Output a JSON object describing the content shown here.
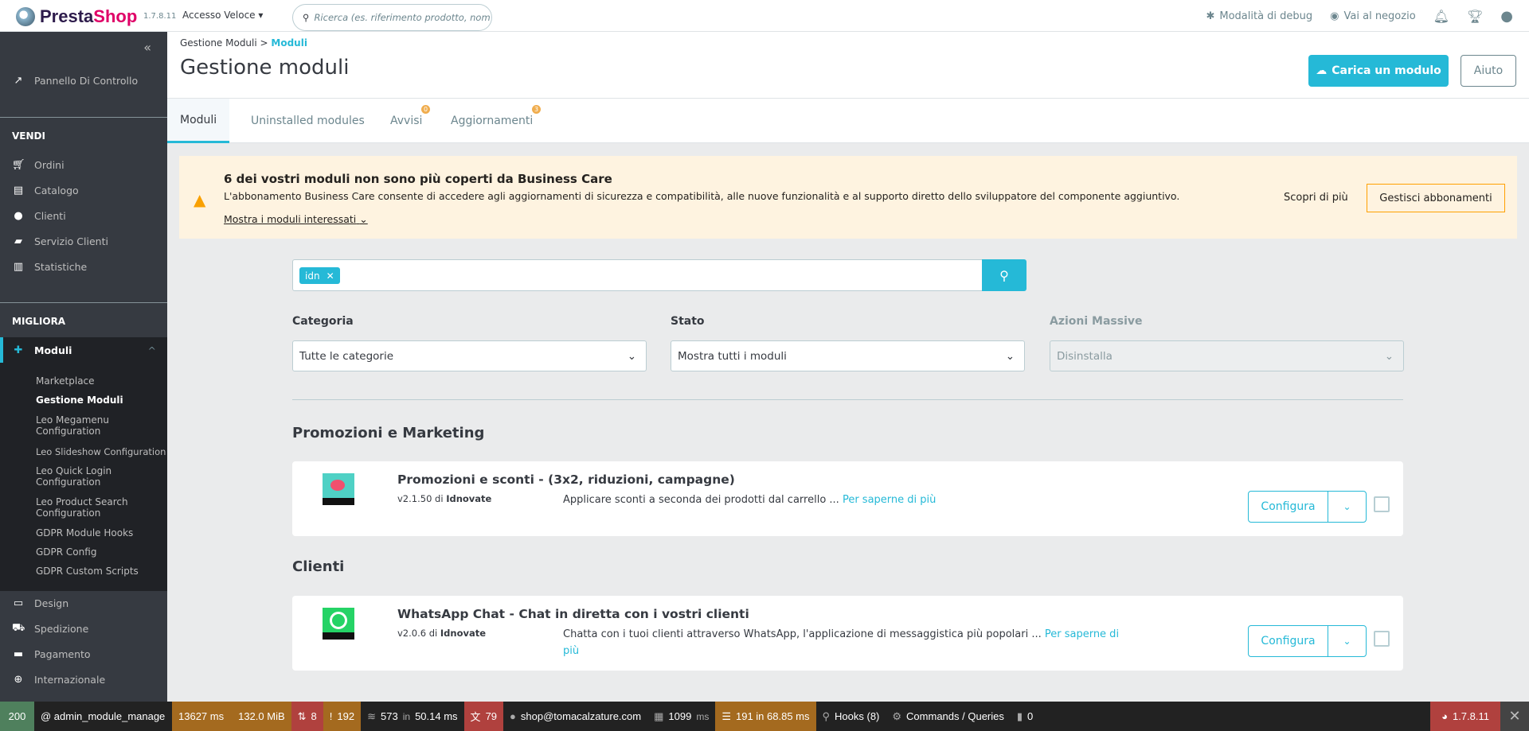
{
  "header": {
    "brand": "PrestaShop",
    "version": "1.7.8.11",
    "quick_access": "Accesso Veloce",
    "search_placeholder": "Ricerca (es. riferimento prodotto, nom",
    "debug_mode": "Modalità di debug",
    "view_shop": "Vai al negozio"
  },
  "sidebar": {
    "dashboard": "Pannello Di Controllo",
    "section_sell": "VENDI",
    "sell_items": [
      "Ordini",
      "Catalogo",
      "Clienti",
      "Servizio Clienti",
      "Statistiche"
    ],
    "section_improve": "MIGLIORA",
    "modules": "Moduli",
    "module_sub": [
      "Marketplace",
      "Gestione Moduli",
      "Leo Megamenu Configuration",
      "Leo Slideshow Configuration",
      "Leo Quick Login Configuration",
      "Leo Product Search Configuration",
      "GDPR Module Hooks",
      "GDPR Config",
      "GDPR Custom Scripts"
    ],
    "other_items": [
      "Design",
      "Spedizione",
      "Pagamento",
      "Internazionale"
    ]
  },
  "page": {
    "breadcrumb_parent": "Gestione Moduli",
    "breadcrumb_current": "Moduli",
    "title": "Gestione moduli",
    "upload_button": "Carica un modulo",
    "help_button": "Aiuto"
  },
  "tabs": [
    {
      "label": "Moduli"
    },
    {
      "label": "Uninstalled modules"
    },
    {
      "label": "Avvisi",
      "badge": "0"
    },
    {
      "label": "Aggiornamenti",
      "badge": "3"
    }
  ],
  "banner": {
    "title": "6 dei vostri moduli non sono più coperti da Business Care",
    "text": "L'abbonamento Business Care consente di accedere agli aggiornamenti di sicurezza e compatibilità, alle nuove funzionalità e al supporto diretto dello sviluppatore del componente aggiuntivo.",
    "show_link": "Mostra i moduli interessati",
    "learn_more": "Scopri di più",
    "manage": "Gestisci abbonamenti"
  },
  "search": {
    "tag": "idn"
  },
  "filters": {
    "category_label": "Categoria",
    "category_value": "Tutte le categorie",
    "status_label": "Stato",
    "status_value": "Mostra tutti i moduli",
    "bulk_label": "Azioni Massive",
    "bulk_value": "Disinstalla"
  },
  "sections": [
    {
      "title": "Promozioni e Marketing",
      "module": {
        "name": "Promozioni e sconti - (3x2, riduzioni, campagne)",
        "version": "v2.1.50 di",
        "author": "Idnovate",
        "description": "Applicare sconti a seconda dei prodotti dal carrello ...",
        "more": "Per saperne di più",
        "configure": "Configura"
      }
    },
    {
      "title": "Clienti",
      "module": {
        "name": "WhatsApp Chat - Chat in diretta con i vostri clienti",
        "version": "v2.0.6 di",
        "author": "Idnovate",
        "description": "Chatta con i tuoi clienti attraverso WhatsApp, l'applicazione di messaggistica più popolari ...",
        "more": "Per saperne di più",
        "configure": "Configura"
      }
    }
  ],
  "debug": {
    "status": "200",
    "route": "@ admin_module_manage",
    "time": "13627 ms",
    "memory": "132.0 MiB",
    "redirects": "8",
    "errors": "192",
    "queries": "573",
    "queries_in": "in",
    "queries_time": "50.14 ms",
    "translations": "79",
    "user": "shop@tomacalzature.com",
    "twig": "1099",
    "twig_unit": "ms",
    "cache": "191 in 68.85 ms",
    "hooks": "Hooks (8)",
    "commands": "Commands / Queries",
    "fuel": "0",
    "ps_version": "1.7.8.11"
  },
  "colors": {
    "accent": "#25b9d7",
    "sidebar": "#363a41",
    "warning": "#f9a001"
  }
}
